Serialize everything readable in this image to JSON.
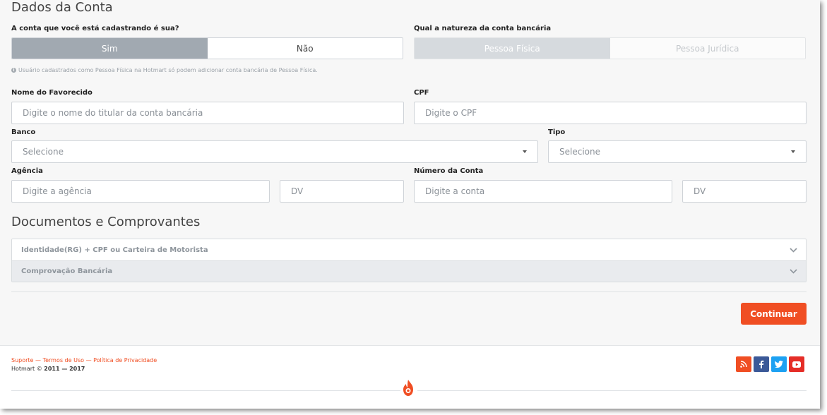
{
  "account_section": {
    "title": "Dados da Conta",
    "ownership_question": "A conta que você está cadastrando é sua?",
    "ownership_options": [
      "Sim",
      "Não"
    ],
    "ownership_selected": "Sim",
    "nature_question": "Qual a natureza da conta bancária",
    "nature_options": [
      "Pessoa Física",
      "Pessoa Jurídica"
    ],
    "nature_selected": "Pessoa Física",
    "hint": "Usuário cadastrados como Pessoa Física na Hotmart só podem adicionar conta bancária de Pessoa Física."
  },
  "form": {
    "favorecido": {
      "label": "Nome do Favorecido",
      "placeholder": "Digite o nome do titular da conta bancária",
      "value": ""
    },
    "cpf": {
      "label": "CPF",
      "placeholder": "Digite o CPF",
      "value": ""
    },
    "banco": {
      "label": "Banco",
      "selected": "Selecione"
    },
    "tipo": {
      "label": "Tipo",
      "selected": "Selecione"
    },
    "agencia": {
      "label": "Agência",
      "placeholder": "Digite a agência",
      "dv_placeholder": "DV"
    },
    "conta": {
      "label": "Número da Conta",
      "placeholder": "Digite a conta",
      "dv_placeholder": "DV"
    }
  },
  "documents_section": {
    "title": "Documentos e Comprovantes",
    "items": [
      {
        "label": "Identidade(RG) + CPF ou Carteira de Motorista"
      },
      {
        "label": "Comprovação Bancária"
      }
    ]
  },
  "actions": {
    "continue_label": "Continuar"
  },
  "footer": {
    "links": [
      "Suporte",
      "Termos de Uso",
      "Política de Privacidade"
    ],
    "separator": " — ",
    "copyright_prefix": "Hotmart © ",
    "copyright_years": "2011 — 2017",
    "social": [
      {
        "icon": "rss-icon",
        "color": "#f04e23"
      },
      {
        "icon": "facebook-icon",
        "color": "#3b5998"
      },
      {
        "icon": "twitter-icon",
        "color": "#1da1f2"
      },
      {
        "icon": "youtube-icon",
        "color": "#e52d27"
      }
    ],
    "brand_icon": "hotmart-flame-icon",
    "brand_color": "#f04e23"
  }
}
